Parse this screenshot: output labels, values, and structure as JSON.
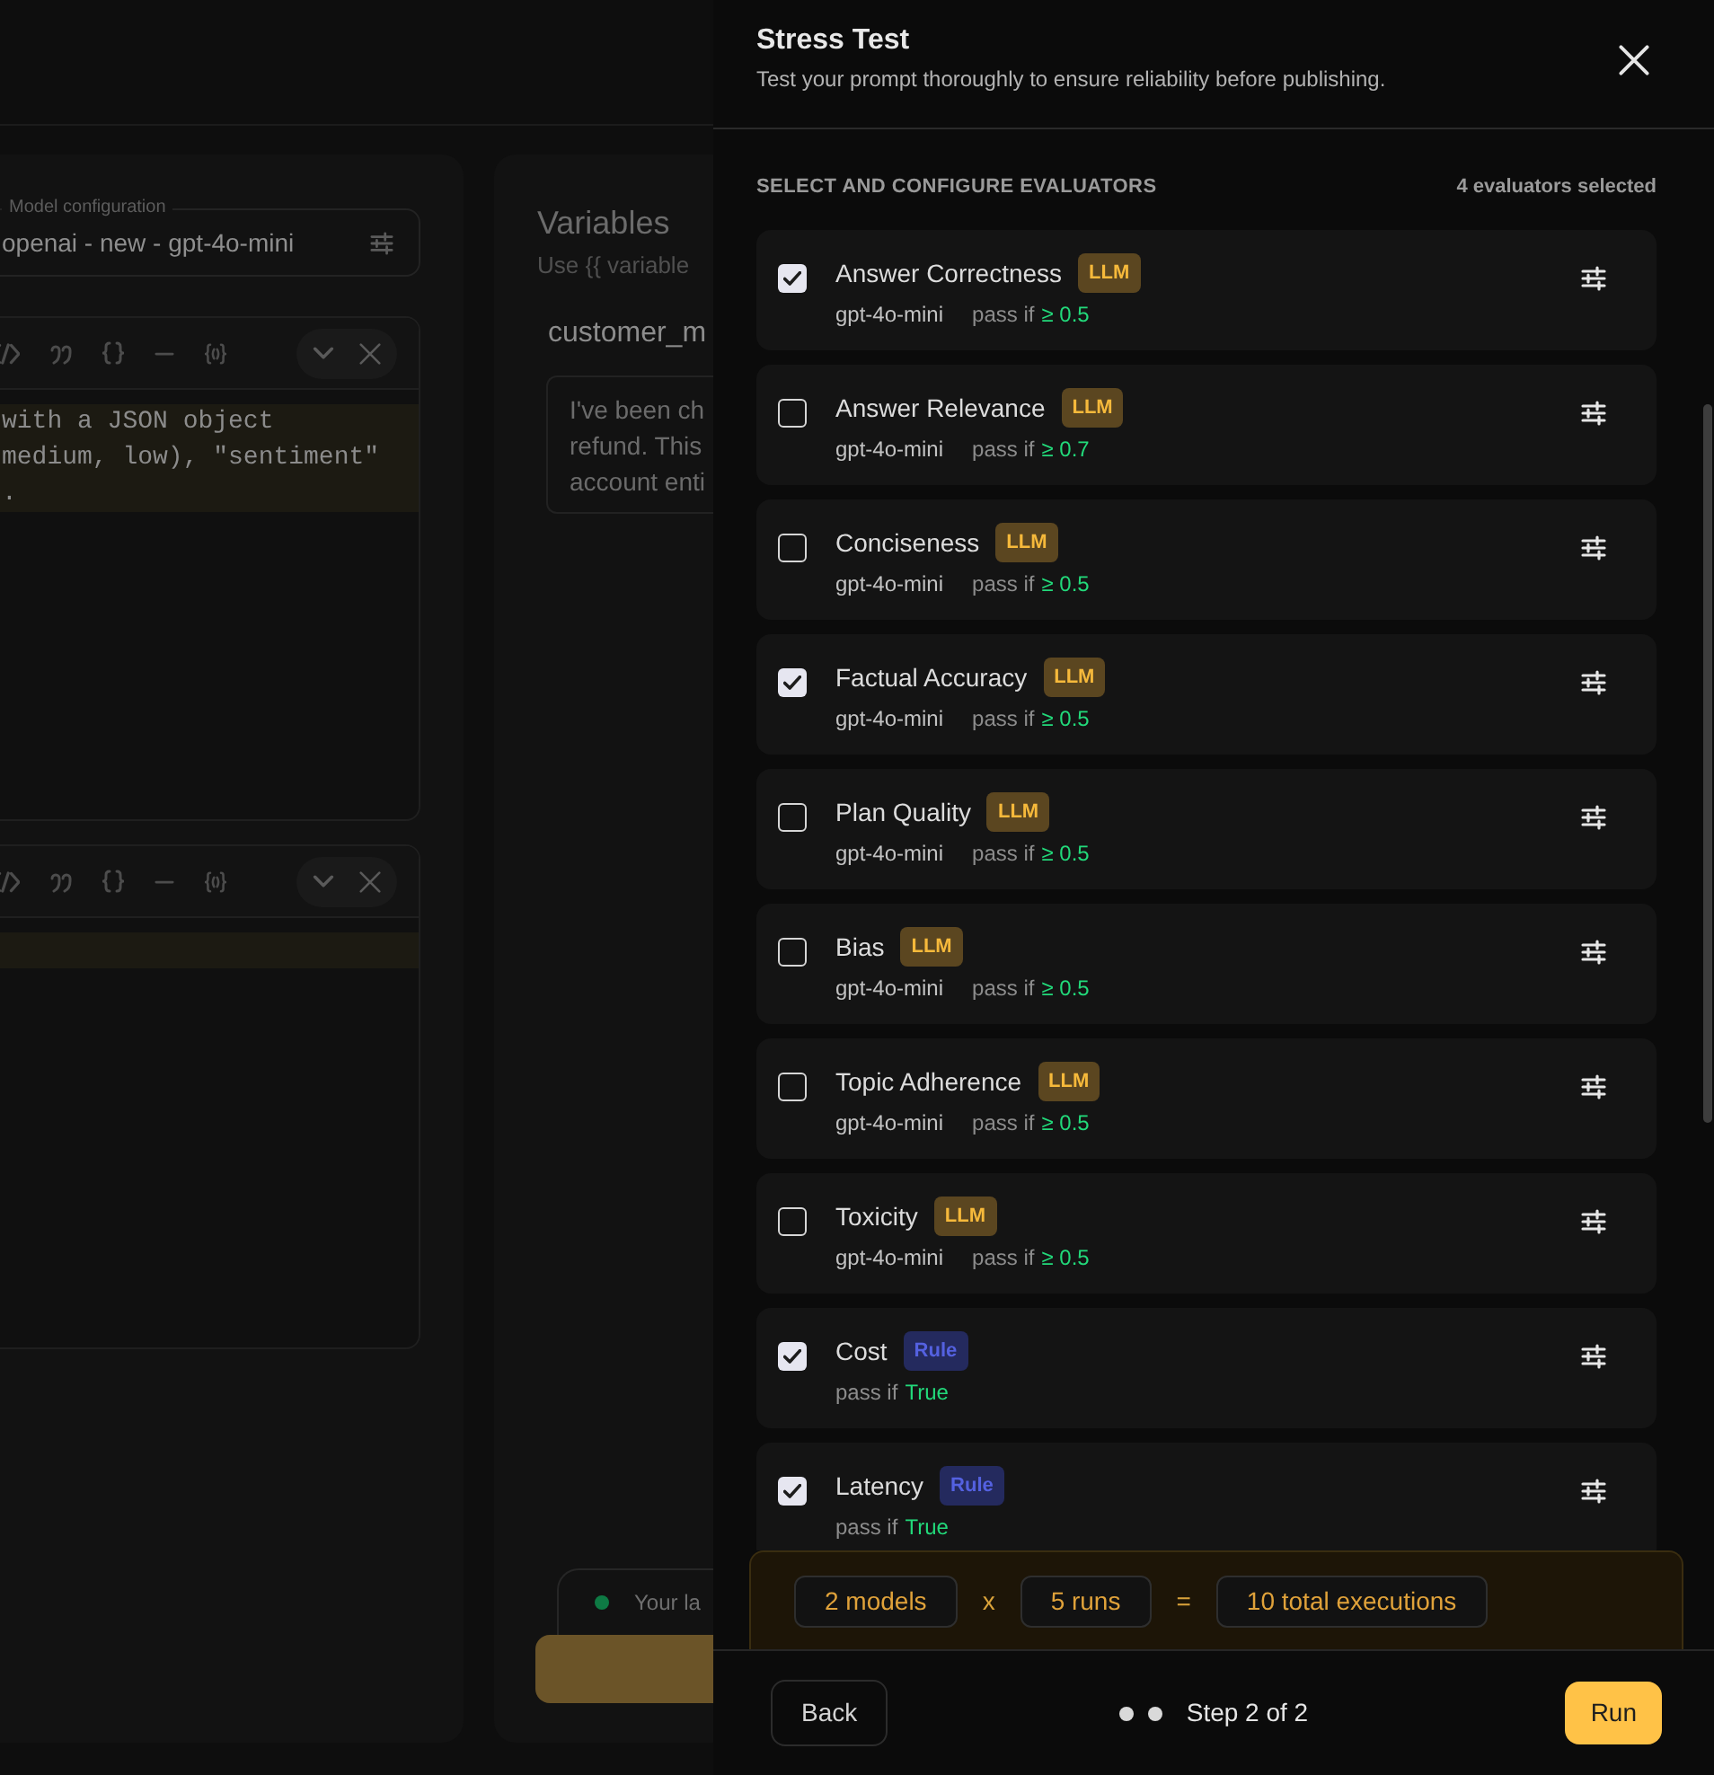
{
  "background": {
    "model_config": {
      "label": "Model configuration",
      "value": "openai - new - gpt-4o-mini"
    },
    "editors": [
      {
        "kind": "code",
        "lines": [
          "with a JSON object",
          "medium, low), \"sentiment\"",
          "."
        ]
      },
      {
        "kind": "empty"
      }
    ],
    "variables": {
      "title": "Variables",
      "hint": "Use {{ variable",
      "name": "customer_m",
      "value_lines": [
        "I've been ch",
        "refund. This",
        "account enti"
      ]
    },
    "toast": {
      "text": "Your la"
    }
  },
  "drawer": {
    "title": "Stress Test",
    "subtitle": "Test your prompt thoroughly to ensure reliability before publishing.",
    "section_title": "SELECT AND CONFIGURE EVALUATORS",
    "selected_count": "4 evaluators selected",
    "evaluators": [
      {
        "name": "Answer Correctness",
        "kind": "llm",
        "badge": "LLM",
        "model": "gpt-4o-mini",
        "pass_label": "pass if",
        "threshold": "≥ 0.5",
        "checked": true
      },
      {
        "name": "Answer Relevance",
        "kind": "llm",
        "badge": "LLM",
        "model": "gpt-4o-mini",
        "pass_label": "pass if",
        "threshold": "≥ 0.7",
        "checked": false
      },
      {
        "name": "Conciseness",
        "kind": "llm",
        "badge": "LLM",
        "model": "gpt-4o-mini",
        "pass_label": "pass if",
        "threshold": "≥ 0.5",
        "checked": false
      },
      {
        "name": "Factual Accuracy",
        "kind": "llm",
        "badge": "LLM",
        "model": "gpt-4o-mini",
        "pass_label": "pass if",
        "threshold": "≥ 0.5",
        "checked": true
      },
      {
        "name": "Plan Quality",
        "kind": "llm",
        "badge": "LLM",
        "model": "gpt-4o-mini",
        "pass_label": "pass if",
        "threshold": "≥ 0.5",
        "checked": false
      },
      {
        "name": "Bias",
        "kind": "llm",
        "badge": "LLM",
        "model": "gpt-4o-mini",
        "pass_label": "pass if",
        "threshold": "≥ 0.5",
        "checked": false
      },
      {
        "name": "Topic Adherence",
        "kind": "llm",
        "badge": "LLM",
        "model": "gpt-4o-mini",
        "pass_label": "pass if",
        "threshold": "≥ 0.5",
        "checked": false
      },
      {
        "name": "Toxicity",
        "kind": "llm",
        "badge": "LLM",
        "model": "gpt-4o-mini",
        "pass_label": "pass if",
        "threshold": "≥ 0.5",
        "checked": false
      },
      {
        "name": "Cost",
        "kind": "rule",
        "badge": "Rule",
        "pass_label": "pass if",
        "threshold": "True",
        "checked": true
      },
      {
        "name": "Latency",
        "kind": "rule",
        "badge": "Rule",
        "pass_label": "pass if",
        "threshold": "True",
        "checked": true
      }
    ],
    "summary": {
      "models": "2 models",
      "times": "x",
      "runs": "5 runs",
      "equals": "=",
      "total": "10 total executions"
    },
    "footer": {
      "back": "Back",
      "steps": [
        {
          "active": true
        },
        {
          "active": true
        }
      ],
      "step_label": "Step 2 of 2",
      "run": "Run"
    }
  }
}
